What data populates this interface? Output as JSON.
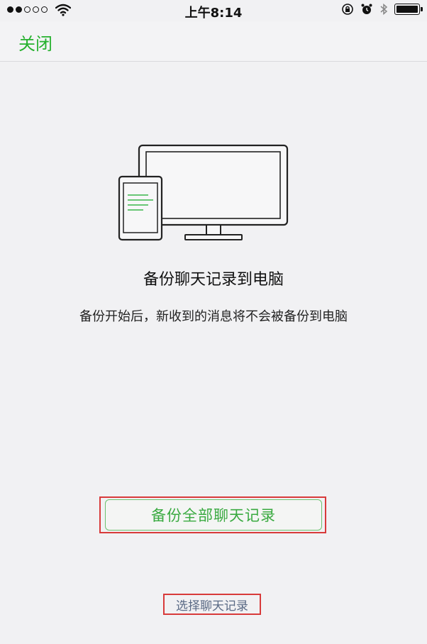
{
  "status_bar": {
    "time": "上午8:14",
    "signal_bars_filled": 2,
    "signal_bars_total": 5,
    "icons": [
      "wifi-icon",
      "orientation-lock-icon",
      "alarm-icon",
      "bluetooth-icon",
      "battery-icon"
    ],
    "battery_level": 1.0
  },
  "nav": {
    "close_label": "关闭"
  },
  "main": {
    "title": "备份聊天记录到电脑",
    "subtitle": "备份开始后，新收到的消息将不会被备份到电脑",
    "illustration_icons": [
      "monitor-icon",
      "phone-icon"
    ]
  },
  "actions": {
    "backup_all_label": "备份全部聊天记录",
    "select_chats_label": "选择聊天记录"
  },
  "colors": {
    "accent_green": "#26b12e",
    "link_gray": "#5a6a85",
    "highlight_red": "#d83a3a"
  }
}
